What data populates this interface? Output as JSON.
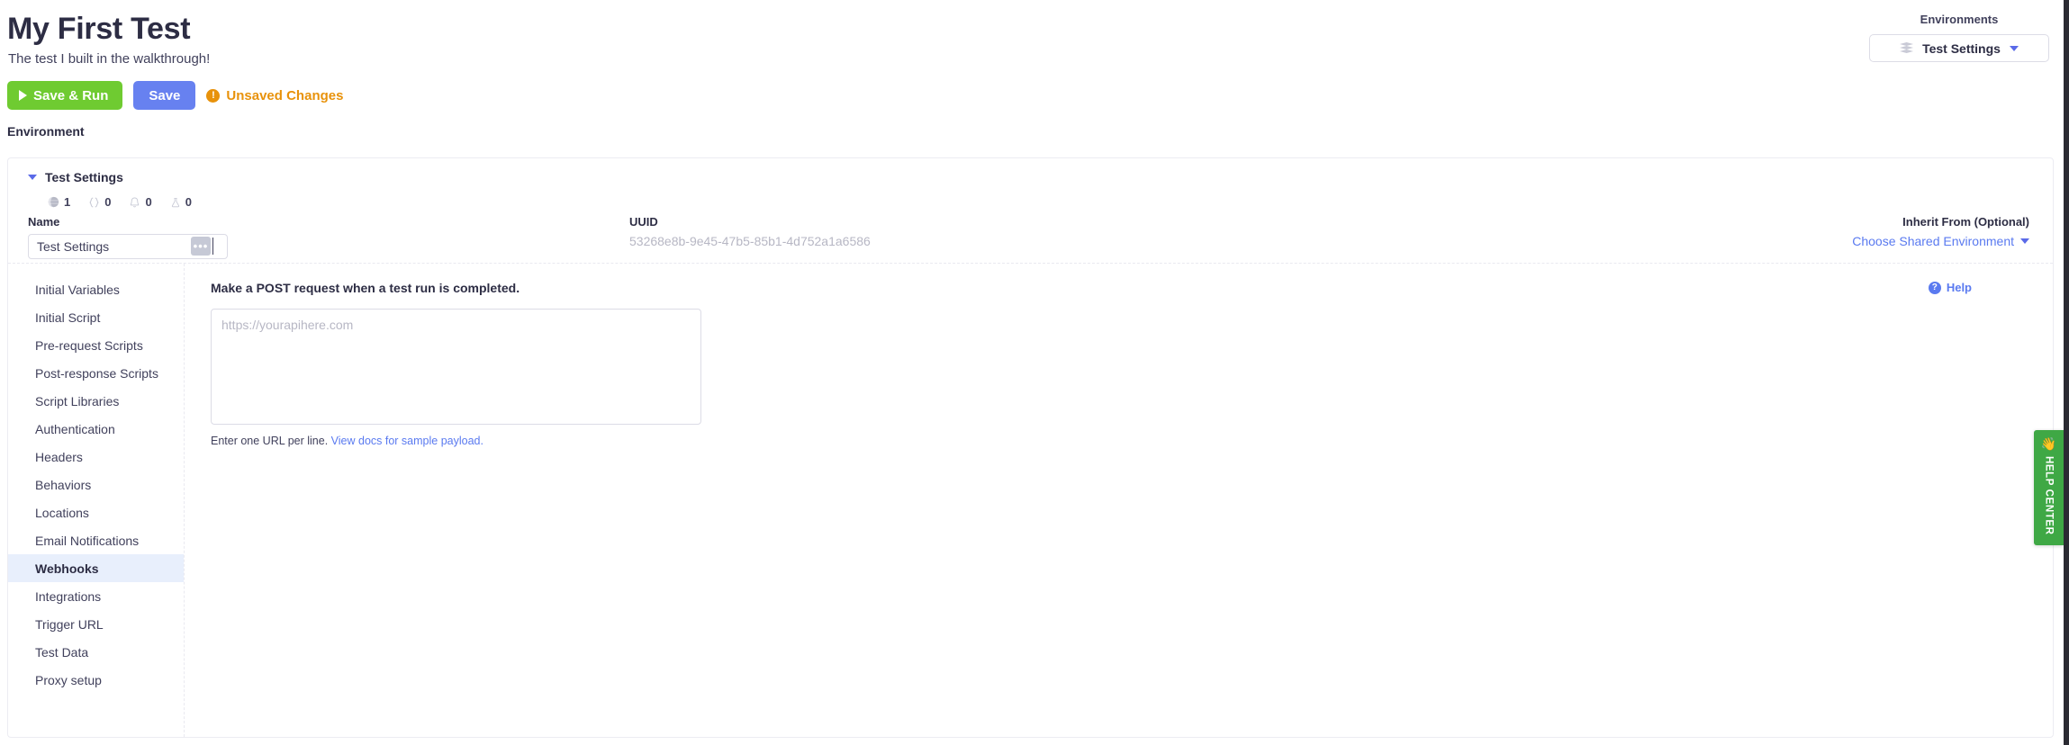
{
  "header": {
    "title": "My First Test",
    "subtitle": "The test I built in the walkthrough!",
    "save_run_label": "Save & Run",
    "save_label": "Save",
    "unsaved_label": "Unsaved Changes",
    "environment_label": "Environment"
  },
  "environments": {
    "label": "Environments",
    "selected": "Test Settings"
  },
  "card": {
    "title": "Test Settings",
    "stats": [
      {
        "icon": "globe-icon",
        "value": "1"
      },
      {
        "icon": "braces-icon",
        "value": "0"
      },
      {
        "icon": "bell-icon",
        "value": "0"
      },
      {
        "icon": "flask-icon",
        "value": "0"
      }
    ],
    "name": {
      "label": "Name",
      "value": "Test Settings",
      "menu_label": "•••"
    },
    "uuid": {
      "label": "UUID",
      "value": "53268e8b-9e45-47b5-85b1-4d752a1a6586"
    },
    "inherit": {
      "label": "Inherit From (Optional)",
      "link": "Choose Shared Environment"
    }
  },
  "sidebar": {
    "items": [
      {
        "label": "Initial Variables",
        "active": false
      },
      {
        "label": "Initial Script",
        "active": false
      },
      {
        "label": "Pre-request Scripts",
        "active": false
      },
      {
        "label": "Post-response Scripts",
        "active": false
      },
      {
        "label": "Script Libraries",
        "active": false
      },
      {
        "label": "Authentication",
        "active": false
      },
      {
        "label": "Headers",
        "active": false
      },
      {
        "label": "Behaviors",
        "active": false
      },
      {
        "label": "Locations",
        "active": false
      },
      {
        "label": "Email Notifications",
        "active": false
      },
      {
        "label": "Webhooks",
        "active": true
      },
      {
        "label": "Integrations",
        "active": false
      },
      {
        "label": "Trigger URL",
        "active": false
      },
      {
        "label": "Test Data",
        "active": false
      },
      {
        "label": "Proxy setup",
        "active": false
      }
    ]
  },
  "content": {
    "title": "Make a POST request when a test run is completed.",
    "help_label": "Help",
    "url_placeholder": "https://yourapihere.com",
    "url_value": "",
    "hint_text": "Enter one URL per line.",
    "hint_link": "View docs for sample payload."
  },
  "help_center": {
    "label": "HELP CENTER",
    "emoji": "👋"
  },
  "colors": {
    "green": "#6fcb31",
    "blue": "#6781f0",
    "orange": "#e8920b",
    "link": "#5a7af0",
    "active_bg": "#e8effc",
    "help_center_green": "#3fa845"
  }
}
